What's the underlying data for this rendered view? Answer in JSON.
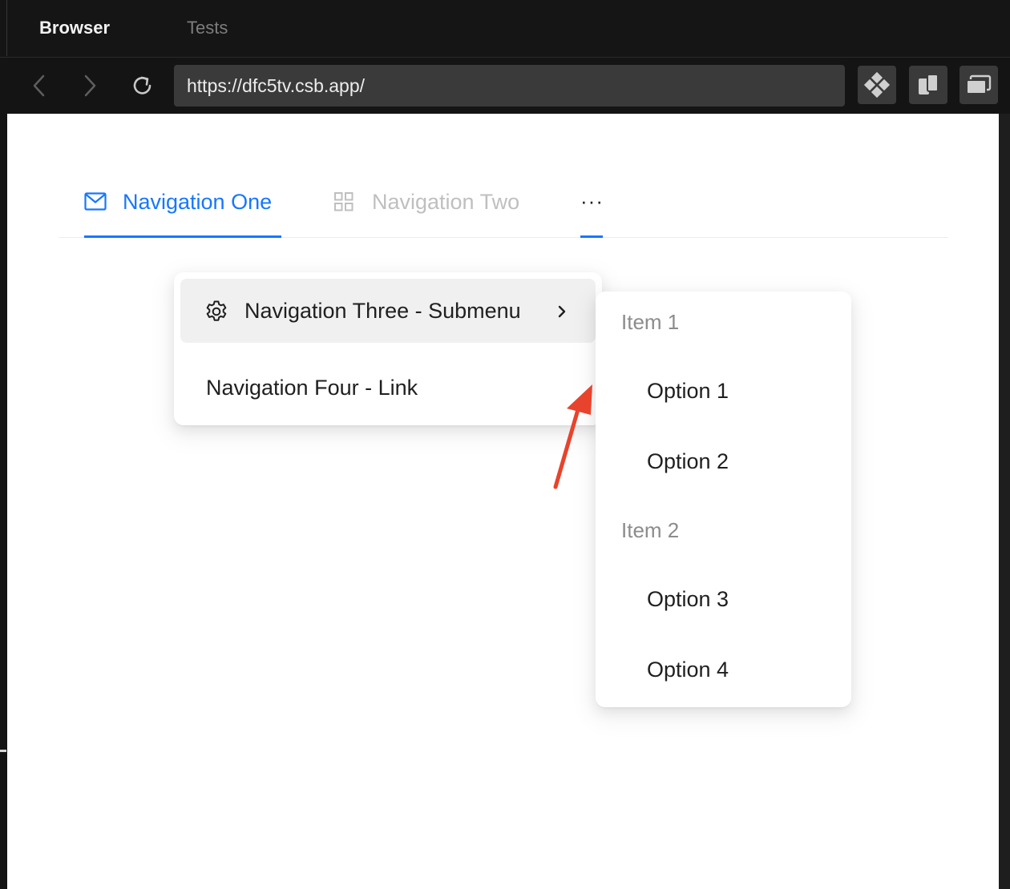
{
  "browser": {
    "tabs": [
      {
        "label": "Browser",
        "active": true
      },
      {
        "label": "Tests",
        "active": false
      }
    ],
    "url": "https://dfc5tv.csb.app/",
    "toolbar_icons": [
      "back-icon",
      "forward-icon",
      "reload-icon",
      "extension-icon",
      "split-view-icon",
      "windows-icon"
    ]
  },
  "menu": {
    "items": [
      {
        "label": "Navigation One",
        "icon": "mail-icon",
        "active": true
      },
      {
        "label": "Navigation Two",
        "icon": "appstore-icon",
        "active": false,
        "disabled": true
      }
    ],
    "overflow_label": "···",
    "accent_color": "#1677ff"
  },
  "dropdown": {
    "items": [
      {
        "label": "Navigation Three - Submenu",
        "icon": "setting-icon",
        "has_submenu": true
      },
      {
        "label": "Navigation Four - Link"
      }
    ]
  },
  "submenu": {
    "groups": [
      {
        "title": "Item 1",
        "options": [
          "Option 1",
          "Option 2"
        ]
      },
      {
        "title": "Item 2",
        "options": [
          "Option 3",
          "Option 4"
        ]
      }
    ]
  },
  "annotation": {
    "arrow_color": "#e8432d"
  }
}
